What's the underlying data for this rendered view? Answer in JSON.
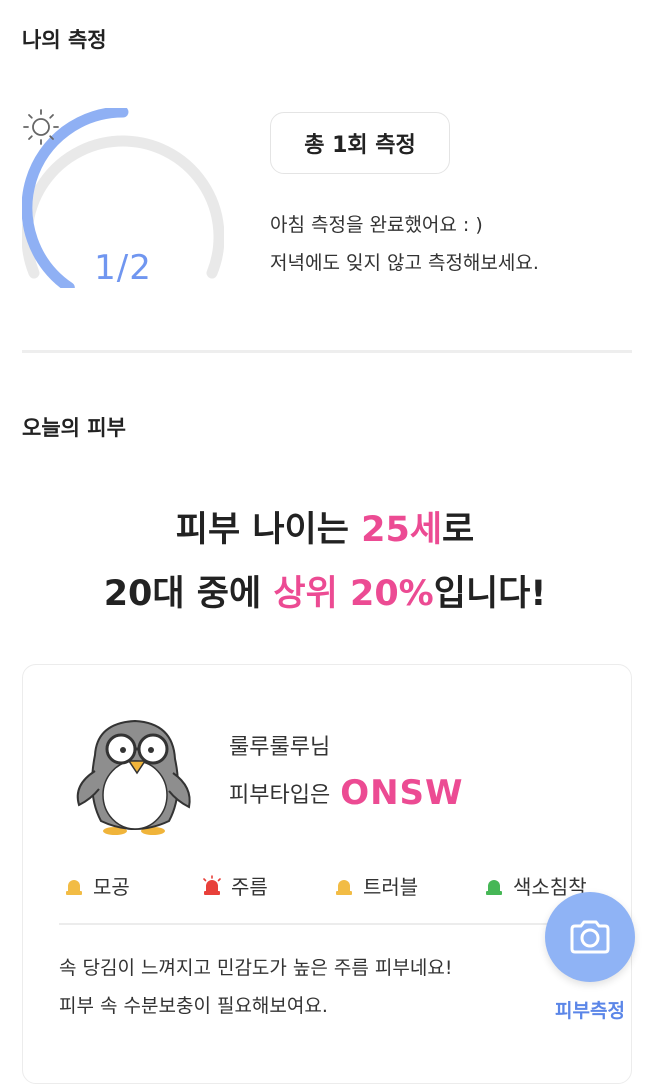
{
  "my_measure": {
    "title": "나의 측정",
    "progress": {
      "current": 1,
      "total": 2,
      "label": "1/2",
      "fraction": 0.5
    },
    "total_badge": "총 1회 측정",
    "message_line1": "아침 측정을 완료했어요 : )",
    "message_line2": "저녁에도 잊지 않고 측정해보세요."
  },
  "today_skin": {
    "title": "오늘의 피부",
    "headline": {
      "l1_a": "피부 나이는 ",
      "l1_b": "25세",
      "l1_c": "로",
      "l2_a": "20대 중에 ",
      "l2_b": "상위 20%",
      "l2_c": "입니다!"
    },
    "profile": {
      "nickname": "룰루룰루님",
      "skin_type_label": "피부타입은",
      "skin_type": "ONSW"
    },
    "tags": [
      {
        "label": "모공",
        "icon": "alert-light-icon",
        "color": "#f2bc45"
      },
      {
        "label": "주름",
        "icon": "alert-light-icon",
        "color": "#e8403a"
      },
      {
        "label": "트러블",
        "icon": "alert-light-icon",
        "color": "#f2bc45"
      },
      {
        "label": "색소침착",
        "icon": "alert-light-icon",
        "color": "#46b756"
      }
    ],
    "description_line1": "속 당김이 느껴지고 민감도가 높은 주름 피부네요!",
    "description_line2": "피부 속 수분보충이 필요해보여요."
  },
  "fab": {
    "label": "피부측정",
    "icon": "camera-icon"
  },
  "colors": {
    "accent_blue": "#7096f0",
    "pink": "#ec4b93",
    "track": "#e9e9e9"
  }
}
